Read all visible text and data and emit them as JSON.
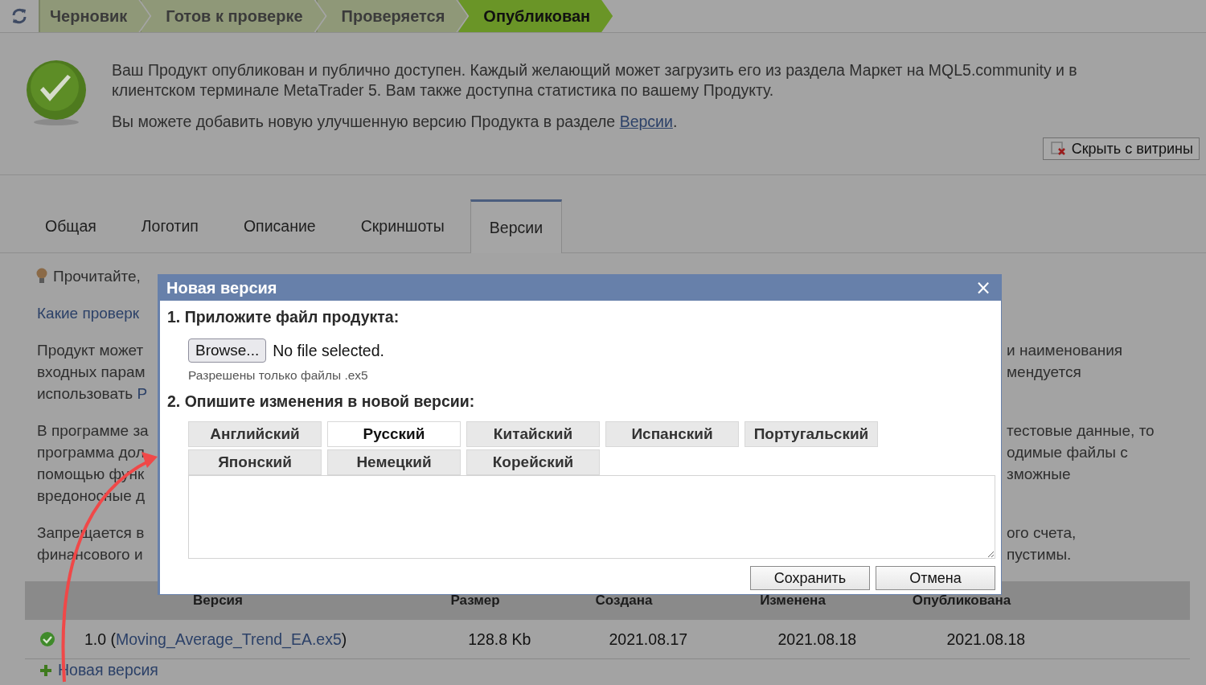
{
  "status_steps": [
    {
      "label": "Черновик",
      "selected": false
    },
    {
      "label": "Готов к проверке",
      "selected": false
    },
    {
      "label": "Проверяется",
      "selected": false
    },
    {
      "label": "Опубликован",
      "selected": true
    }
  ],
  "notice": {
    "text": "Ваш Продукт опубликован и публично доступен. Каждый желающий может загрузить его из раздела Маркет на MQL5.community и в клиентском терминале MetaTrader 5. Вам также доступна статистика по вашему Продукту.",
    "text2_prefix": "Вы можете добавить новую улучшенную версию Продукта в разделе ",
    "text2_link": "Версии",
    "text2_suffix": "."
  },
  "hide_button": "Скрыть с витрины",
  "tabs": [
    {
      "label": "Общая",
      "selected": false
    },
    {
      "label": "Логотип",
      "selected": false
    },
    {
      "label": "Описание",
      "selected": false
    },
    {
      "label": "Скриншоты",
      "selected": false
    },
    {
      "label": "Версии",
      "selected": true
    }
  ],
  "hint": "Прочитайте,",
  "checks_link": "Какие проверк",
  "paragraphs": [
    {
      "left": [
        {
          "text": "Продукт может"
        },
        {
          "text": "входных парам"
        },
        {
          "text": "использовать ",
          "link": "Р"
        }
      ],
      "right": [
        "и наименования",
        "мендуется"
      ]
    },
    {
      "left": [
        {
          "text": "В программе за"
        },
        {
          "text": "программа дол"
        },
        {
          "text": "помощью функ"
        },
        {
          "text": "вредоносные д"
        }
      ],
      "right": [
        "тестовые данные, то",
        "одимые файлы с",
        "зможные"
      ]
    },
    {
      "left": [
        {
          "text": "Запрещается в"
        },
        {
          "text": "финансового и"
        }
      ],
      "right": [
        "ого счета,",
        "пустимы."
      ]
    }
  ],
  "table": {
    "columns": [
      "Версия",
      "Размер",
      "Создана",
      "Изменена",
      "Опубликована"
    ],
    "rows": [
      {
        "published": true,
        "version_prefix": "1.0 (",
        "file": "Moving_Average_Trend_EA.ex5",
        "version_suffix": ")",
        "size": "128.8 Kb",
        "created": "2021.08.17",
        "changed": "2021.08.18",
        "published_on": "2021.08.18"
      }
    ]
  },
  "new_version_link": "Новая версия",
  "dialog": {
    "title": "Новая версия",
    "close": "×",
    "step1": "1. Приложите файл продукта:",
    "browse": "Browse...",
    "no_file": "No file selected.",
    "file_hint": "Разрешены только файлы .ex5",
    "step2": "2. Опишите изменения в новой версии:",
    "languages": [
      {
        "label": "Английский",
        "selected": false
      },
      {
        "label": "Русский",
        "selected": true
      },
      {
        "label": "Китайский",
        "selected": false
      },
      {
        "label": "Испанский",
        "selected": false
      },
      {
        "label": "Португальский",
        "selected": false
      },
      {
        "label": "Японский",
        "selected": false
      },
      {
        "label": "Немецкий",
        "selected": false
      },
      {
        "label": "Корейский",
        "selected": false
      }
    ],
    "buttons": [
      "Сохранить",
      "Отмена"
    ]
  }
}
